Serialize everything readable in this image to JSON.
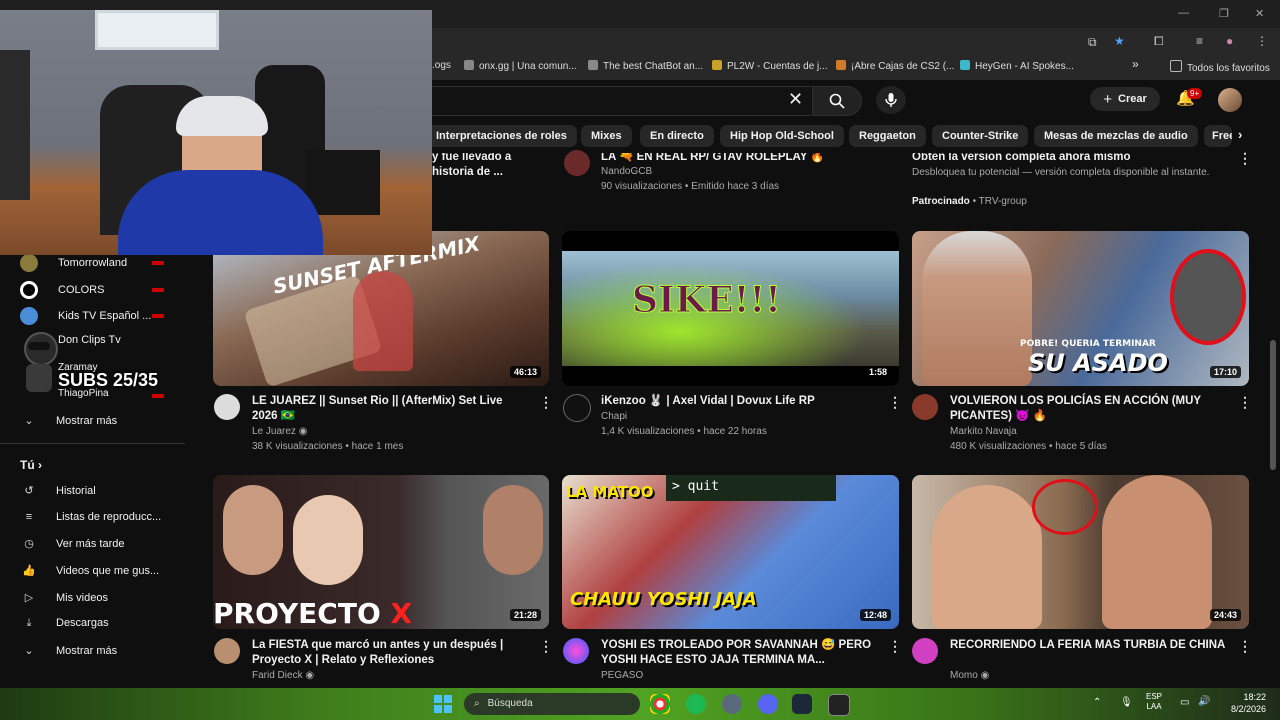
{
  "bookmarks": [
    {
      "label": ".ogs"
    },
    {
      "label": "onx.gg | Una comun..."
    },
    {
      "label": "The best ChatBot an..."
    },
    {
      "label": "PL2W - Cuentas de j..."
    },
    {
      "label": "¡Abre Cajas de CS2 (..."
    },
    {
      "label": "HeyGen - AI Spokes..."
    }
  ],
  "bookmarks_more": "»",
  "bookmarks_all": "Todos los favoritos",
  "header": {
    "create_label": "Crear",
    "notif_badge": "9+"
  },
  "chips": [
    "Interpretaciones de roles",
    "Mixes",
    "En directo",
    "Hip Hop Old-School",
    "Reggaeton",
    "Counter-Strike",
    "Mesas de mezclas de audio",
    "Free"
  ],
  "sidebar": {
    "subscriptions": [
      {
        "name": "Tomorrowland",
        "color": "#8a7a3c",
        "live": true
      },
      {
        "name": "COLORS",
        "color": "#ffffff",
        "live": true
      },
      {
        "name": "Kids TV Español ...",
        "color": "#4a8cd8",
        "live": true
      },
      {
        "name": "Don Clips Tv",
        "color": "#444444",
        "live": false
      },
      {
        "name": "Zaramay",
        "color": "#333333",
        "live": false
      },
      {
        "name": "ThiagoPina",
        "color": "#6a7a6a",
        "live": true
      }
    ],
    "show_more": "Mostrar más",
    "you_label": "Tú",
    "you_items": [
      {
        "label": "Historial",
        "icon": "history-icon"
      },
      {
        "label": "Listas de reproducc...",
        "icon": "playlists-icon"
      },
      {
        "label": "Ver más tarde",
        "icon": "watch-later-icon"
      },
      {
        "label": "Videos que me gus...",
        "icon": "like-icon"
      },
      {
        "label": "Mis videos",
        "icon": "my-videos-icon"
      },
      {
        "label": "Descargas",
        "icon": "download-icon"
      }
    ],
    "show_more_2": "Mostrar más"
  },
  "overlay": {
    "subs_text": "SUBS 25/35"
  },
  "top_row": [
    {
      "title_frag": "y fue llevado a\nhistoria de ..."
    },
    {
      "title": "LA 🔫 EN REAL RP/ GTAV ROLEPLAY 🔥",
      "channel": "NandoGCB",
      "meta": "90 visualizaciones • Emitido hace 3 días"
    },
    {
      "title": "Obtén la versión completa ahora mismo",
      "desc": "Desbloquea tu potencial — versión completa disponible al instante.",
      "sponsored": "Patrocinado",
      "sponsor": " • TRV-group"
    }
  ],
  "videos": [
    {
      "title": "LE JUAREZ || Sunset Rio || (AfterMix) Set Live 2026 🇧🇷",
      "channel": "Le Juarez",
      "verified": true,
      "meta": "38 K visualizaciones • hace 1 mes",
      "duration": "46:13",
      "thumb_text": "SUNSET AFTERMIX"
    },
    {
      "title": "iKenzoo 🐰 | Axel Vidal | Dovux Life RP",
      "channel": "Chapi",
      "verified": false,
      "meta": "1,4 K visualizaciones • hace 22 horas",
      "duration": "1:58",
      "thumb_text": "SIKE!!!"
    },
    {
      "title": "VOLVIERON LOS POLICÍAS EN ACCIÓN (MUY PICANTES) 👿 🔥",
      "channel": "Markito Navaja",
      "verified": false,
      "meta": "480 K visualizaciones • hace 5 días",
      "duration": "17:10",
      "thumb_text": "POBRE! QUERIA TERMINAR SU ASADO"
    },
    {
      "title": "La FIESTA que marcó un antes y un después | Proyecto X | Relato y Reflexiones",
      "channel": "Farid Dieck",
      "verified": true,
      "meta": "",
      "duration": "21:28",
      "thumb_text": "PROYECTO X"
    },
    {
      "title": "YOSHI ES TROLEADO POR SAVANNAH 😅 PERO YOSHI HACE ESTO  JAJA TERMINA MA...",
      "channel": "PEGASO",
      "verified": false,
      "meta": "",
      "duration": "12:48",
      "thumb_text": "CHAUU YOSHI JAJA"
    },
    {
      "title": "RECORRIENDO LA FERIA MAS TURBIA DE CHINA",
      "channel": "Momo",
      "verified": true,
      "meta": "",
      "duration": "24:43",
      "thumb_text": ""
    }
  ],
  "taskbar": {
    "search_label": "Búsqueda",
    "lang1": "ESP",
    "lang2": "LAA",
    "time": "18:22",
    "date": "8/2/2026"
  }
}
